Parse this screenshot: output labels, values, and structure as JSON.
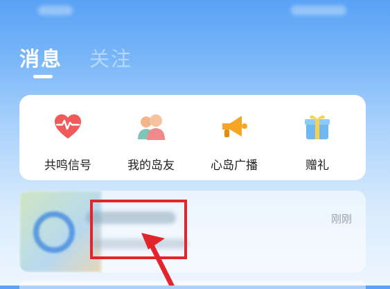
{
  "header": {
    "tabs": [
      {
        "label": "消息",
        "active": true
      },
      {
        "label": "关注",
        "active": false
      }
    ]
  },
  "quick_actions": [
    {
      "label": "共鸣信号",
      "icon": "heart-pulse-icon"
    },
    {
      "label": "我的岛友",
      "icon": "friends-icon"
    },
    {
      "label": "心岛广播",
      "icon": "megaphone-icon"
    },
    {
      "label": "赠礼",
      "icon": "gift-icon"
    }
  ],
  "messages": [
    {
      "time": "刚刚"
    }
  ],
  "colors": {
    "accent": "#5aa2f5",
    "highlight": "#e3252b",
    "heart": "#f05a5a",
    "megaphone": "#f6a623"
  }
}
